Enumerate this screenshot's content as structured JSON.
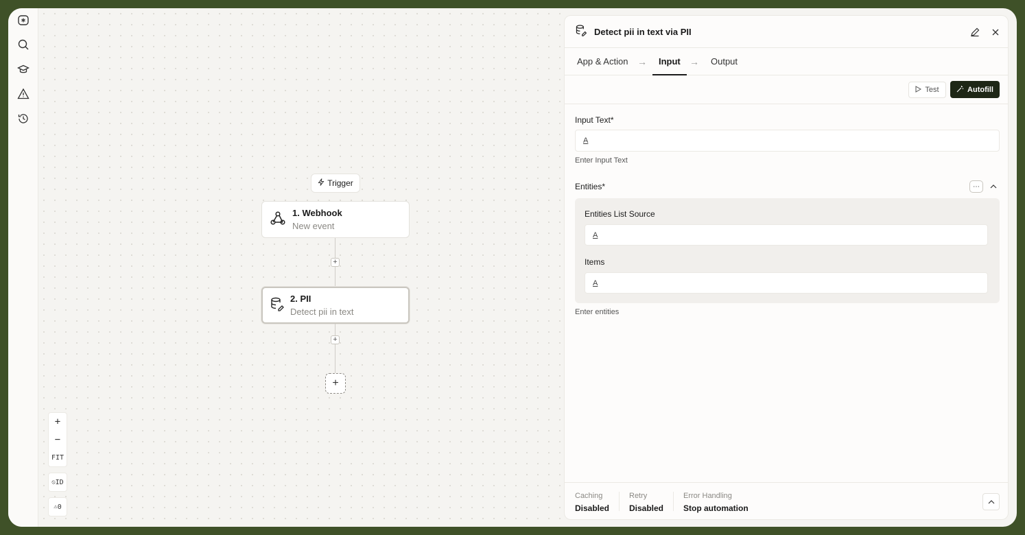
{
  "sidebar": {
    "items": [
      {
        "icon": "logo-icon"
      },
      {
        "icon": "search-icon"
      },
      {
        "icon": "graduation-cap-icon"
      },
      {
        "icon": "warning-icon"
      },
      {
        "icon": "history-icon"
      }
    ]
  },
  "canvas": {
    "trigger_label": "Trigger",
    "nodes": [
      {
        "title": "1. Webhook",
        "subtitle": "New event",
        "icon": "webhook-icon"
      },
      {
        "title": "2. PII",
        "subtitle": "Detect pii in text",
        "icon": "database-icon"
      }
    ],
    "zoom": {
      "in": "+",
      "out": "−",
      "fit": "FIT"
    },
    "id_toggle": "ID",
    "warning_count": "0"
  },
  "panel": {
    "title": "Detect pii in text via PII",
    "tabs": [
      "App & Action",
      "Input",
      "Output"
    ],
    "active_tab": "Input",
    "test_label": "Test",
    "autofill_label": "Autofill",
    "input_text": {
      "label": "Input Text*",
      "hint": "Enter Input Text"
    },
    "entities": {
      "label": "Entities*",
      "list_source_label": "Entities List Source",
      "items_label": "Items",
      "hint": "Enter entities"
    },
    "footer": [
      {
        "label": "Caching",
        "value": "Disabled"
      },
      {
        "label": "Retry",
        "value": "Disabled"
      },
      {
        "label": "Error Handling",
        "value": "Stop automation"
      }
    ]
  },
  "colors": {
    "frame_bg": "#3f5128",
    "autofill_bg": "#1e2716"
  }
}
